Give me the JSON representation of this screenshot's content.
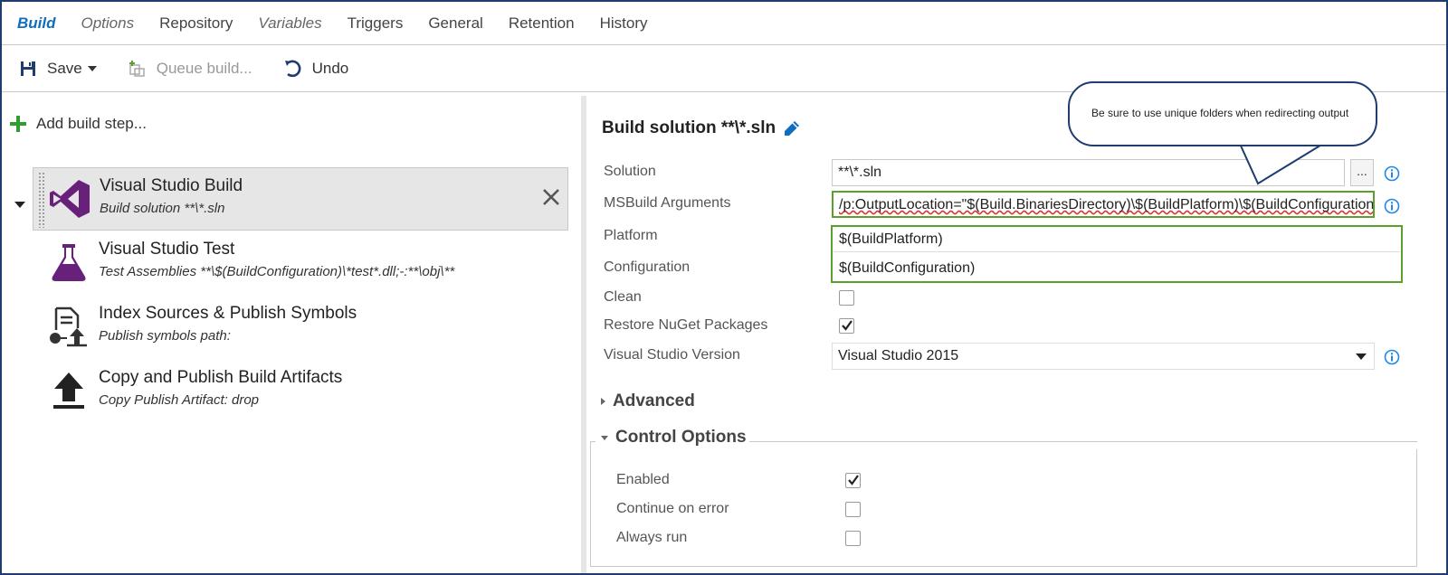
{
  "tabs": [
    {
      "label": "Build",
      "style": "active"
    },
    {
      "label": "Options",
      "style": "italic"
    },
    {
      "label": "Repository",
      "style": "normal"
    },
    {
      "label": "Variables",
      "style": "italic"
    },
    {
      "label": "Triggers",
      "style": "normal"
    },
    {
      "label": "General",
      "style": "normal"
    },
    {
      "label": "Retention",
      "style": "normal"
    },
    {
      "label": "History",
      "style": "normal"
    }
  ],
  "toolbar": {
    "save_label": "Save",
    "queue_label": "Queue build...",
    "undo_label": "Undo"
  },
  "left": {
    "add_step_label": "Add build step...",
    "steps": [
      {
        "title": "Visual Studio Build",
        "subtitle": "Build solution **\\*.sln",
        "icon": "visual-studio-icon"
      },
      {
        "title": "Visual Studio Test",
        "subtitle": "Test Assemblies **\\$(BuildConfiguration)\\*test*.dll;-:**\\obj\\**",
        "icon": "flask-icon"
      },
      {
        "title": "Index Sources & Publish Symbols",
        "subtitle": "Publish symbols path:",
        "icon": "publish-symbols-icon"
      },
      {
        "title": "Copy and Publish Build Artifacts",
        "subtitle": "Copy Publish Artifact: drop",
        "icon": "upload-arrow-icon"
      }
    ]
  },
  "right": {
    "title": "Build solution **\\*.sln",
    "fields": {
      "solution": {
        "label": "Solution",
        "value": "**\\*.sln"
      },
      "msbuild": {
        "label": "MSBuild Arguments",
        "value": "/p:OutputLocation=\"$(Build.BinariesDirectory)\\$(BuildPlatform)\\$(BuildConfiguration)\""
      },
      "platform": {
        "label": "Platform",
        "value": "$(BuildPlatform)"
      },
      "configuration": {
        "label": "Configuration",
        "value": "$(BuildConfiguration)"
      },
      "clean": {
        "label": "Clean",
        "checked": false
      },
      "restore": {
        "label": "Restore NuGet Packages",
        "checked": true
      },
      "vsversion": {
        "label": "Visual Studio Version",
        "value": "Visual Studio 2015"
      }
    },
    "ellipsis_label": "...",
    "advanced_label": "Advanced",
    "control_options_label": "Control Options",
    "control_options": {
      "enabled": {
        "label": "Enabled",
        "checked": true
      },
      "continue": {
        "label": "Continue on error",
        "checked": false
      },
      "always": {
        "label": "Always run",
        "checked": false
      }
    }
  },
  "callout": {
    "text": "Be sure to use unique folders when redirecting output"
  },
  "colors": {
    "active_tab": "#106ebe",
    "vs_purple": "#68217a",
    "highlight_green": "#5aa02c",
    "callout_border": "#1f3c6e",
    "info_blue": "#1e88e5"
  }
}
